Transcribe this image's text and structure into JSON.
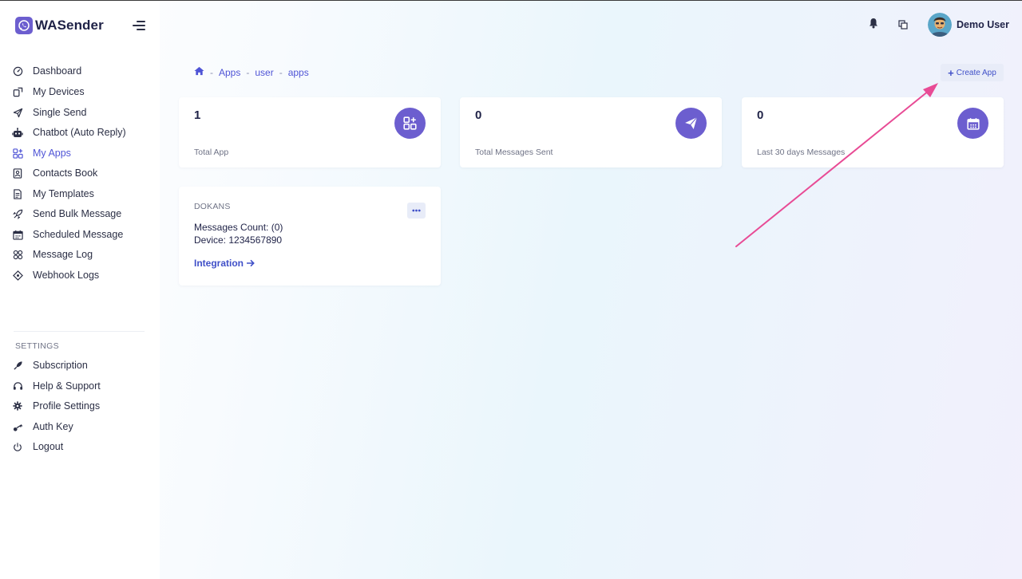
{
  "brand": {
    "name": "WASender"
  },
  "sidebar": {
    "items": [
      {
        "label": "Dashboard",
        "icon": "dashboard-icon"
      },
      {
        "label": "My Devices",
        "icon": "devices-icon"
      },
      {
        "label": "Single Send",
        "icon": "send-icon"
      },
      {
        "label": "Chatbot (Auto Reply)",
        "icon": "robot-icon"
      },
      {
        "label": "My Apps",
        "icon": "apps-icon",
        "active": true
      },
      {
        "label": "Contacts Book",
        "icon": "contacts-icon"
      },
      {
        "label": "My Templates",
        "icon": "templates-icon"
      },
      {
        "label": "Send Bulk Message",
        "icon": "rocket-icon"
      },
      {
        "label": "Scheduled Message",
        "icon": "calendar-icon"
      },
      {
        "label": "Message Log",
        "icon": "log-icon"
      },
      {
        "label": "Webhook Logs",
        "icon": "webhook-icon"
      }
    ],
    "settings_title": "SETTINGS",
    "settings_items": [
      {
        "label": "Subscription",
        "icon": "subscription-icon"
      },
      {
        "label": "Help & Support",
        "icon": "headset-icon"
      },
      {
        "label": "Profile Settings",
        "icon": "gear-icon"
      },
      {
        "label": "Auth Key",
        "icon": "key-icon"
      },
      {
        "label": "Logout",
        "icon": "power-icon"
      }
    ]
  },
  "header": {
    "username": "Demo User"
  },
  "breadcrumb": {
    "items": [
      "Apps",
      "user",
      "apps"
    ]
  },
  "create_button": {
    "label": "Create App"
  },
  "stats": [
    {
      "value": "1",
      "label": "Total App",
      "icon": "apps-icon"
    },
    {
      "value": "0",
      "label": "Total Messages Sent",
      "icon": "paper-plane-icon"
    },
    {
      "value": "0",
      "label": "Last 30 days Messages",
      "icon": "calendar-icon"
    }
  ],
  "app_card": {
    "name": "DOKANS",
    "messages_count": "Messages Count: (0)",
    "device": "Device: 1234567890",
    "link": "Integration"
  },
  "colors": {
    "accent": "#6c5ecf",
    "link": "#4f54d6",
    "annotation_arrow": "#e84b95"
  }
}
